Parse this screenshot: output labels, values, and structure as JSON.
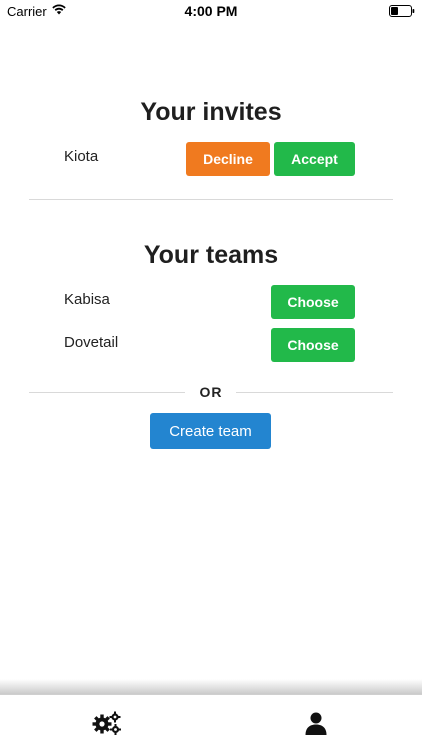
{
  "status_bar": {
    "carrier": "Carrier",
    "time": "4:00 PM",
    "icons": [
      "wifi-icon",
      "battery-icon"
    ]
  },
  "invites": {
    "title": "Your invites",
    "items": [
      {
        "name": "Kiota",
        "decline_label": "Decline",
        "accept_label": "Accept"
      }
    ]
  },
  "teams": {
    "title": "Your teams",
    "items": [
      {
        "name": "Kabisa",
        "choose_label": "Choose"
      },
      {
        "name": "Dovetail",
        "choose_label": "Choose"
      }
    ]
  },
  "separator_text": "OR",
  "create_team_label": "Create team",
  "tab_bar": {
    "tabs": [
      {
        "icon": "gears-icon"
      },
      {
        "icon": "user-icon"
      }
    ]
  },
  "colors": {
    "decline": "#f07a1f",
    "accept": "#22b94a",
    "choose": "#22b94a",
    "create": "#2385d0"
  }
}
